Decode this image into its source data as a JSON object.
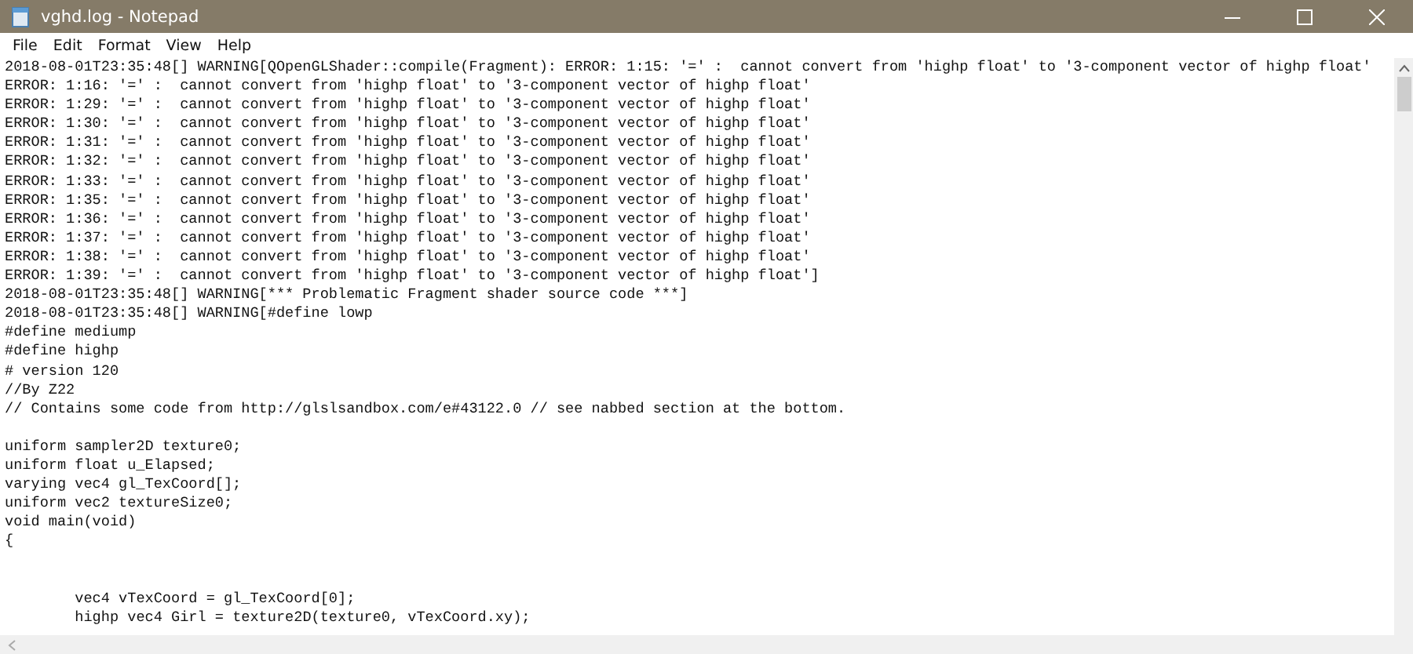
{
  "window": {
    "title": "vghd.log - Notepad"
  },
  "menu": [
    "File",
    "Edit",
    "Format",
    "View",
    "Help"
  ],
  "lines": [
    {
      "kind": "text",
      "text": "2018-08-01T23:35:48[] WARNING[QOpenGLShader::compile(Fragment): ERROR: 1:15: '=' :  cannot convert from 'highp float' to '3-component vector of highp float'"
    },
    {
      "kind": "text",
      "text": "ERROR: 1:16: '=' :  cannot convert from 'highp float' to '3-component vector of highp float'"
    },
    {
      "kind": "text",
      "text": "ERROR: 1:29: '=' :  cannot convert from 'highp float' to '3-component vector of highp float'"
    },
    {
      "kind": "text",
      "text": "ERROR: 1:30: '=' :  cannot convert from 'highp float' to '3-component vector of highp float'"
    },
    {
      "kind": "text",
      "text": "ERROR: 1:31: '=' :  cannot convert from 'highp float' to '3-component vector of highp float'"
    },
    {
      "kind": "text",
      "text": "ERROR: 1:32: '=' :  cannot convert from 'highp float' to '3-component vector of highp float'"
    },
    {
      "kind": "text",
      "text": "ERROR: 1:33: '=' :  cannot convert from 'highp float' to '3-component vector of highp float'"
    },
    {
      "kind": "text",
      "text": "ERROR: 1:35: '=' :  cannot convert from 'highp float' to '3-component vector of highp float'"
    },
    {
      "kind": "text",
      "text": "ERROR: 1:36: '=' :  cannot convert from 'highp float' to '3-component vector of highp float'"
    },
    {
      "kind": "text",
      "text": "ERROR: 1:37: '=' :  cannot convert from 'highp float' to '3-component vector of highp float'"
    },
    {
      "kind": "text",
      "text": "ERROR: 1:38: '=' :  cannot convert from 'highp float' to '3-component vector of highp float'"
    },
    {
      "kind": "text",
      "text": "ERROR: 1:39: '=' :  cannot convert from 'highp float' to '3-component vector of highp float']"
    },
    {
      "kind": "text",
      "text": "2018-08-01T23:35:48[] WARNING[*** Problematic Fragment shader source code ***]"
    },
    {
      "kind": "text",
      "text": "2018-08-01T23:35:48[] WARNING[#define lowp"
    },
    {
      "kind": "text",
      "text": "#define mediump"
    },
    {
      "kind": "text",
      "text": "#define highp"
    },
    {
      "kind": "text",
      "text": "# version 120"
    },
    {
      "kind": "text",
      "text": "//By Z22"
    },
    {
      "kind": "text",
      "text": "// Contains some code from http://glslsandbox.com/e#43122.0 // see nabbed section at the bottom."
    },
    {
      "kind": "blank"
    },
    {
      "kind": "text",
      "text": "uniform sampler2D texture0;"
    },
    {
      "kind": "text",
      "text": "uniform float u_Elapsed;"
    },
    {
      "kind": "text",
      "text": "varying vec4 gl_TexCoord[];"
    },
    {
      "kind": "text",
      "text": "uniform vec2 textureSize0;"
    },
    {
      "kind": "text",
      "text": "void main(void)"
    },
    {
      "kind": "text",
      "text": "{"
    },
    {
      "kind": "blank"
    },
    {
      "kind": "blank"
    },
    {
      "kind": "text",
      "text": "\tvec4 vTexCoord = gl_TexCoord[0];"
    },
    {
      "kind": "text",
      "text": "\thighp vec4 Girl = texture2D(texture0, vTexCoord.xy);"
    }
  ]
}
